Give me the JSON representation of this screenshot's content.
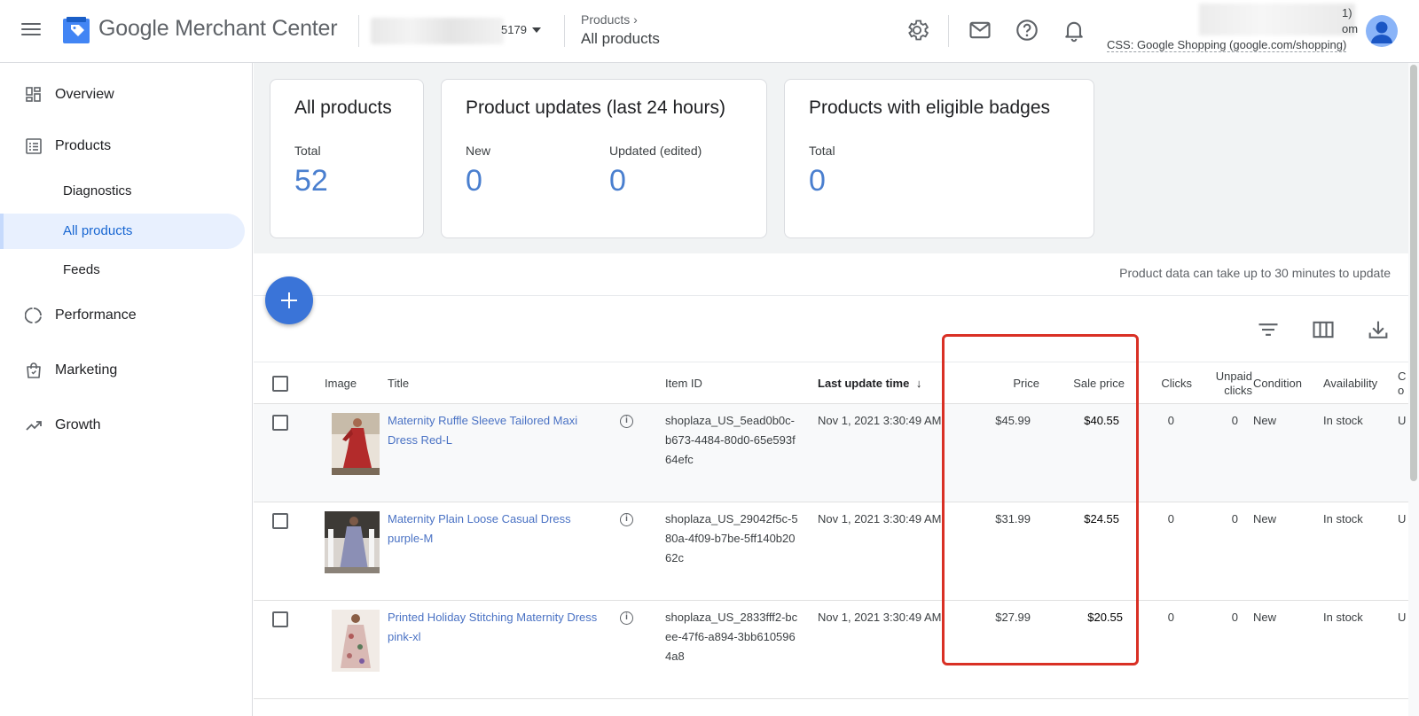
{
  "header": {
    "brand": "Google Merchant Center",
    "account_id_fragment": "5179",
    "breadcrumb_parent": "Products",
    "breadcrumb_current": "All products",
    "user_fragment_1": "1)",
    "user_fragment_2": "om",
    "css_label": "CSS: Google Shopping (google.com/shopping)",
    "icons": [
      "settings-icon",
      "mail-icon",
      "help-icon",
      "notifications-icon"
    ]
  },
  "sidebar": {
    "items": [
      {
        "label": "Overview",
        "icon": "overview-icon"
      },
      {
        "label": "Products",
        "icon": "products-icon"
      },
      {
        "label": "Diagnostics"
      },
      {
        "label": "All products"
      },
      {
        "label": "Feeds"
      },
      {
        "label": "Performance",
        "icon": "performance-icon"
      },
      {
        "label": "Marketing",
        "icon": "marketing-icon"
      },
      {
        "label": "Growth",
        "icon": "growth-icon"
      }
    ]
  },
  "cards": {
    "all_products": {
      "title": "All products",
      "total_label": "Total",
      "total_value": "52"
    },
    "updates": {
      "title": "Product updates (last 24 hours)",
      "new_label": "New",
      "new_value": "0",
      "updated_label": "Updated (edited)",
      "updated_value": "0"
    },
    "badges": {
      "title": "Products with eligible badges",
      "total_label": "Total",
      "total_value": "0"
    }
  },
  "table": {
    "note": "Product data can take up to 30 minutes to update",
    "columns": {
      "image": "Image",
      "title": "Title",
      "item_id": "Item ID",
      "last_update": "Last update time",
      "price": "Price",
      "sale_price": "Sale price",
      "clicks": "Clicks",
      "unpaid_1": "Unpaid",
      "unpaid_2": "clicks",
      "condition": "Condition",
      "availability": "Availability",
      "cut_1": "C",
      "cut_2": "o"
    },
    "rows": [
      {
        "title": "Maternity Ruffle Sleeve Tailored Maxi Dress Red-L",
        "item_id": "shoplaza_US_5ead0b0c-b673-4484-80d0-65e593f64efc",
        "updated": "Nov 1, 2021 3:30:49 AM",
        "price": "$45.99",
        "sale_price": "$40.55",
        "clicks": "0",
        "unpaid": "0",
        "condition": "New",
        "availability": "In stock",
        "cut": "U"
      },
      {
        "title": "Maternity Plain Loose Casual Dress purple-M",
        "item_id": "shoplaza_US_29042f5c-580a-4f09-b7be-5ff140b2062c",
        "updated": "Nov 1, 2021 3:30:49 AM",
        "price": "$31.99",
        "sale_price": "$24.55",
        "clicks": "0",
        "unpaid": "0",
        "condition": "New",
        "availability": "In stock",
        "cut": "U"
      },
      {
        "title": "Printed Holiday Stitching Maternity Dress pink-xl",
        "item_id": "shoplaza_US_2833fff2-bcee-47f6-a894-3bb6105964a8",
        "updated": "Nov 1, 2021 3:30:49 AM",
        "price": "$27.99",
        "sale_price": "$20.55",
        "clicks": "0",
        "unpaid": "0",
        "condition": "New",
        "availability": "In stock",
        "cut": "U"
      }
    ]
  },
  "colors": {
    "accent": "#1a73e8",
    "highlight": "#d93025",
    "value_blue": "#4a7fcf"
  }
}
